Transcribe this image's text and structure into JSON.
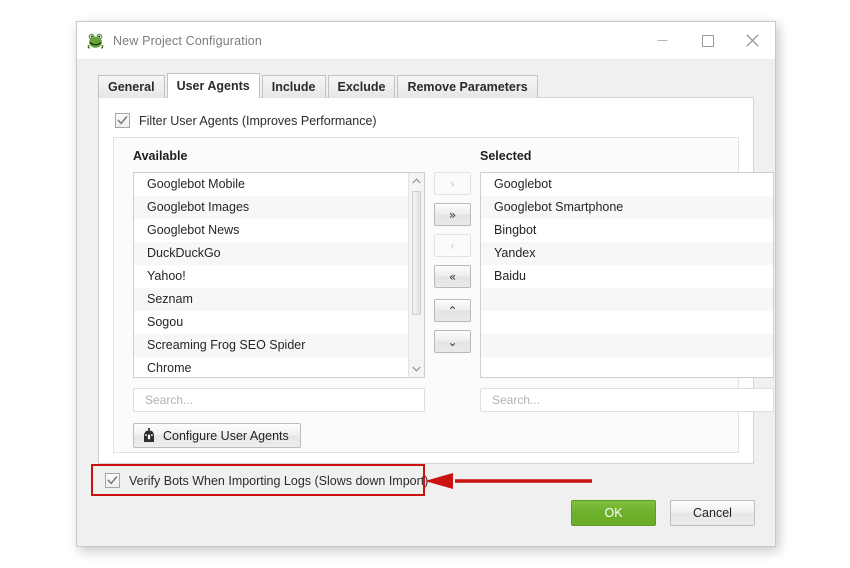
{
  "window": {
    "title": "New Project Configuration",
    "icon": "frog-icon",
    "controls": {
      "minimize": "minimize-icon",
      "maximize": "maximize-icon",
      "close": "close-icon"
    }
  },
  "tabs": [
    {
      "label": "General",
      "active": false
    },
    {
      "label": "User Agents",
      "active": true
    },
    {
      "label": "Include",
      "active": false
    },
    {
      "label": "Exclude",
      "active": false
    },
    {
      "label": "Remove Parameters",
      "active": false
    }
  ],
  "filter_checkbox": {
    "label": "Filter User Agents (Improves Performance)",
    "checked": true
  },
  "available": {
    "title": "Available",
    "items": [
      "Googlebot Mobile",
      "Googlebot Images",
      "Googlebot News",
      "DuckDuckGo",
      "Yahoo!",
      "Seznam",
      "Sogou",
      "Screaming Frog SEO Spider",
      "Chrome"
    ],
    "search_placeholder": "Search..."
  },
  "selected": {
    "title": "Selected",
    "items": [
      "Googlebot",
      "Googlebot Smartphone",
      "Bingbot",
      "Yandex",
      "Baidu"
    ],
    "search_placeholder": "Search..."
  },
  "transfer_buttons": [
    {
      "name": "move-right-single",
      "glyph": "›",
      "enabled": false
    },
    {
      "name": "move-right-all",
      "glyph": "»",
      "enabled": true
    },
    {
      "name": "move-left-single",
      "glyph": "‹",
      "enabled": false
    },
    {
      "name": "move-left-all",
      "glyph": "«",
      "enabled": true
    },
    {
      "name": "move-up",
      "glyph": "⌃",
      "enabled": true
    },
    {
      "name": "move-down",
      "glyph": "⌄",
      "enabled": true
    }
  ],
  "configure_button": {
    "label": "Configure User Agents",
    "icon": "bot-icon"
  },
  "verify_checkbox": {
    "label": "Verify Bots When Importing Logs (Slows down Import)",
    "checked": true
  },
  "footer": {
    "ok_label": "OK",
    "cancel_label": "Cancel"
  },
  "annotation": {
    "shape": "red-rectangle-with-arrow",
    "color": "#cc1111"
  },
  "colors": {
    "ok_green": "#6cb02a",
    "annotation_red": "#cc1111",
    "dialog_background": "#f0f0f0",
    "panel_white": "#ffffff"
  }
}
